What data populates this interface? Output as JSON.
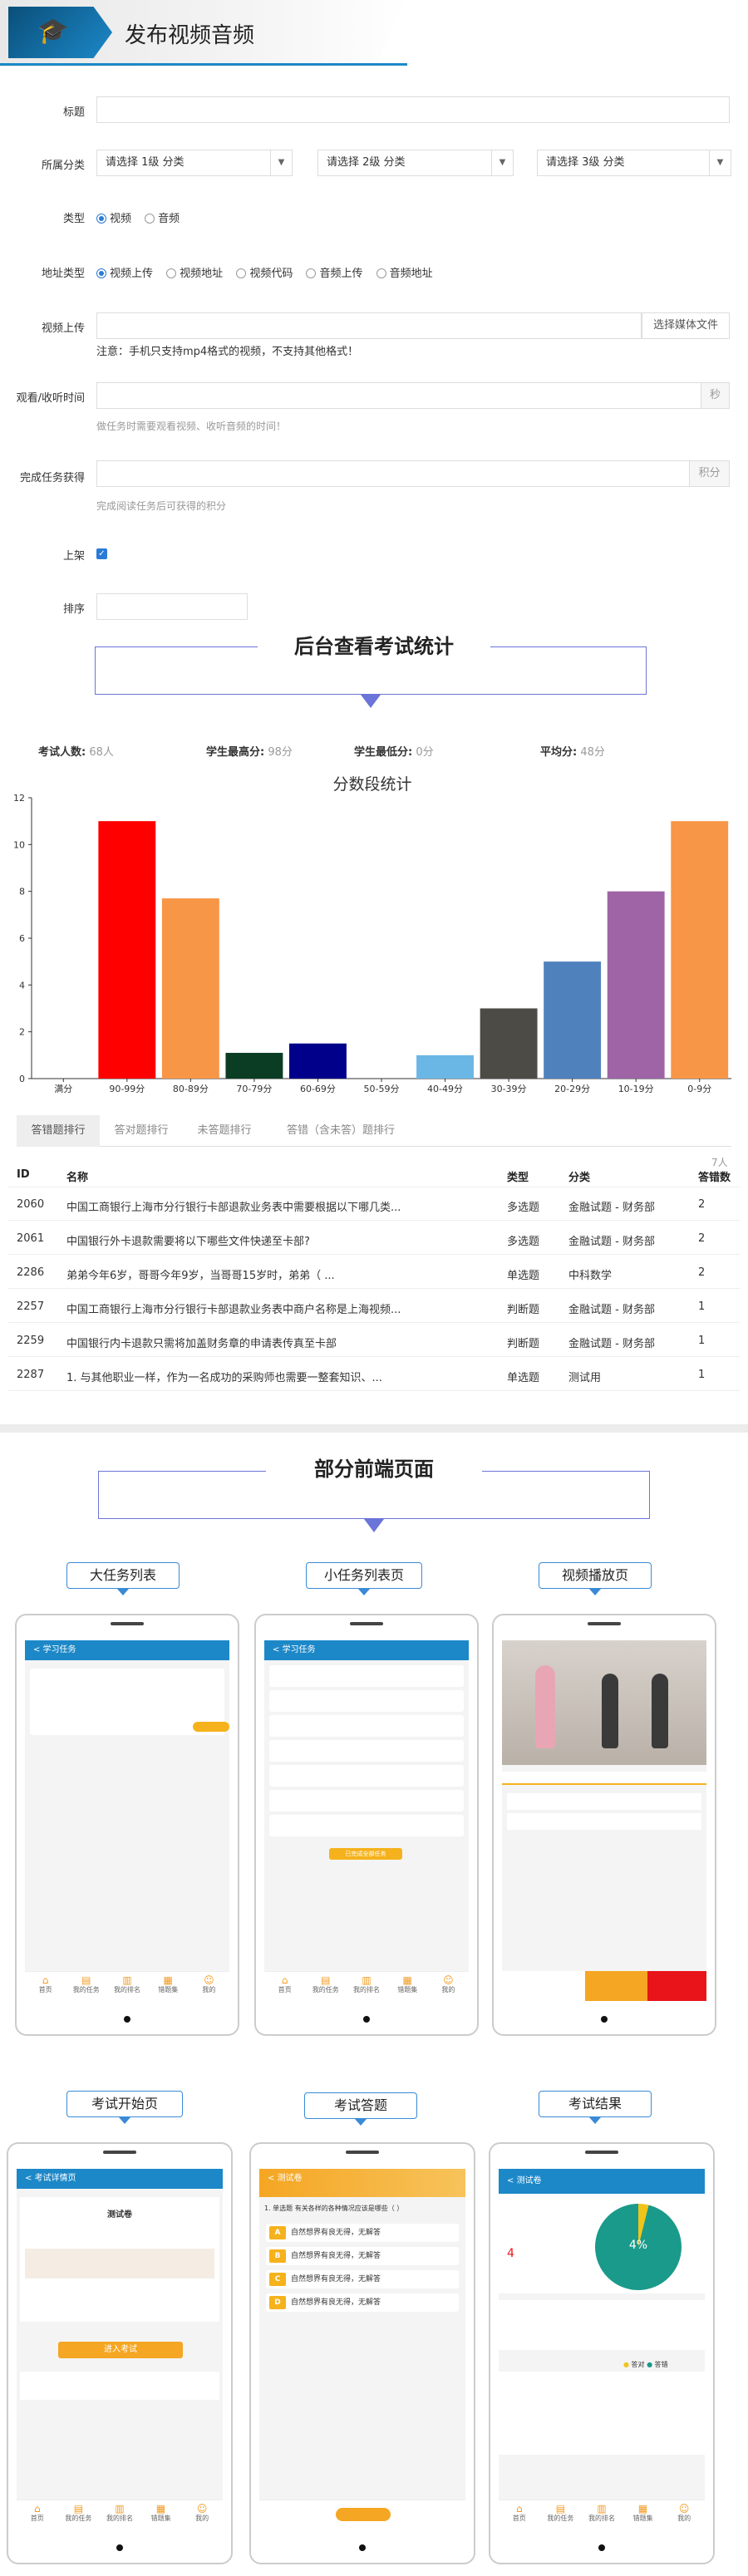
{
  "header": {
    "title": "发布视频音频",
    "icon": "graduation-cap-icon",
    "accent": "#1c88c8"
  },
  "form": {
    "title_label": "标题",
    "category_label": "所属分类",
    "cat1": "请选择 1级 分类",
    "cat2": "请选择 2级 分类",
    "cat3": "请选择 3级 分类",
    "type_label": "类型",
    "type_options": [
      "视频",
      "音频"
    ],
    "addr_label": "地址类型",
    "addr_options": [
      "视频上传",
      "视频地址",
      "视频代码",
      "音频上传",
      "音频地址"
    ],
    "upload_label": "视频上传",
    "upload_button": "选择媒体文件",
    "upload_note": "注意：手机只支持mp4格式的视频，不支持其他格式！",
    "watch_label": "观看/收听时间",
    "watch_unit": "秒",
    "watch_hint": "做任务时需要观看视频、收听音频的时间！",
    "points_label": "完成任务获得",
    "points_unit": "积分",
    "points_hint": "完成阅读任务后可获得的积分",
    "shelf_label": "上架",
    "sort_label": "排序"
  },
  "section1": {
    "title": "后台查看考试统计"
  },
  "stats": {
    "count_label": "考试人数:",
    "count_value": "68人",
    "max_label": "学生最高分:",
    "max_value": "98分",
    "min_label": "学生最低分:",
    "min_value": "0分",
    "avg_label": "平均分:",
    "avg_value": "48分"
  },
  "chart_data": {
    "type": "bar",
    "title": "分数段统计",
    "categories": [
      "满分",
      "90-99分",
      "80-89分",
      "70-79分",
      "60-69分",
      "50-59分",
      "40-49分",
      "30-39分",
      "20-29分",
      "10-19分",
      "0-9分"
    ],
    "values": [
      0,
      11,
      7.7,
      1.1,
      1.5,
      0,
      1,
      3,
      5,
      8,
      11
    ],
    "colors": [
      "#ff0000",
      "#ff0000",
      "#f79646",
      "#0b3d24",
      "#00008b",
      "#999999",
      "#6ab7e6",
      "#4d4b45",
      "#4f81bd",
      "#9f64a6",
      "#f79646"
    ],
    "ylim": [
      0,
      12
    ],
    "yticks": [
      0,
      2,
      4,
      6,
      8,
      10,
      12
    ],
    "grid": false
  },
  "tabs": [
    "答错题排行",
    "答对题排行",
    "未答题排行",
    "答错（含未答）题排行"
  ],
  "table": {
    "unit_note": "7人",
    "headers": [
      "ID",
      "名称",
      "类型",
      "分类",
      "答错数"
    ],
    "rows": [
      [
        "2060",
        "中国工商银行上海市分行银行卡部退款业务表中需要根据以下哪几类...",
        "多选题",
        "金融试题 - 财务部",
        "2"
      ],
      [
        "2061",
        "中国银行外卡退款需要将以下哪些文件快递至卡部?",
        "多选题",
        "金融试题 - 财务部",
        "2"
      ],
      [
        "2286",
        "弟弟今年6岁，哥哥今年9岁，当哥哥15岁时，弟弟（ ...",
        "单选题",
        "中科数学",
        "2"
      ],
      [
        "2257",
        "中国工商银行上海市分行银行卡部退款业务表中商户名称是上海视频...",
        "判断题",
        "金融试题 - 财务部",
        "1"
      ],
      [
        "2259",
        "中国银行内卡退款只需将加盖财务章的申请表传真至卡部",
        "判断题",
        "金融试题 - 财务部",
        "1"
      ],
      [
        "2287",
        "1. 与其他职业一样，作为一名成功的采购师也需要一整套知识、...",
        "单选题",
        "测试用",
        "1"
      ]
    ]
  },
  "section2": {
    "title": "部分前端页面"
  },
  "phones": {
    "p1": {
      "callout": "大任务列表",
      "bar": "学习任务"
    },
    "p2": {
      "callout": "小任务列表页",
      "bar": "学习任务",
      "button": "已完成全部任务"
    },
    "p3": {
      "callout": "视频播放页"
    },
    "p4": {
      "callout": "考试开始页",
      "bar": "考试详情页",
      "title": "测试卷",
      "button": "进入考试"
    },
    "p5": {
      "callout": "考试答题",
      "bar": "测试卷",
      "question": "1. 单选题  有关各样的各种情况应该是哪些（ ）",
      "options": [
        "A",
        "B",
        "C",
        "D"
      ],
      "option_text": "自然想界有良无得，无解答"
    },
    "p6": {
      "callout": "考试结果",
      "bar": "测试卷",
      "percent": "4%",
      "score": "4",
      "legend_correct": "答对",
      "legend_wrong": "答错"
    },
    "nav": [
      "首页",
      "我的任务",
      "我的排名",
      "错题集",
      "我的"
    ]
  }
}
